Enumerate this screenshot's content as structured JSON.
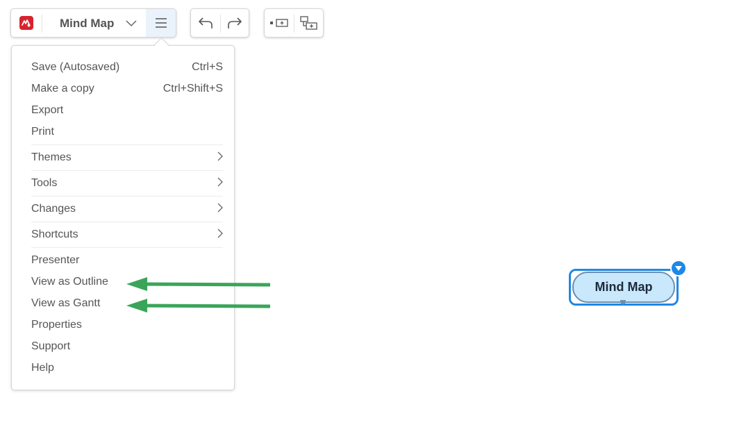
{
  "toolbar": {
    "document_title": "Mind Map",
    "logo_icon": "mindmeister-logo-icon",
    "title_dropdown_icon": "chevron-down-icon",
    "menu_icon": "hamburger-menu-icon",
    "undo_icon": "undo-icon",
    "redo_icon": "redo-icon",
    "add_sibling_icon": "add-sibling-icon",
    "add_child_icon": "add-child-icon"
  },
  "menu": {
    "items": [
      {
        "label": "Save (Autosaved)",
        "shortcut": "Ctrl+S"
      },
      {
        "label": "Make a copy",
        "shortcut": "Ctrl+Shift+S"
      },
      {
        "label": "Export",
        "shortcut": ""
      },
      {
        "label": "Print",
        "shortcut": ""
      },
      {
        "label": "Themes",
        "submenu": true
      },
      {
        "label": "Tools",
        "submenu": true
      },
      {
        "label": "Changes",
        "submenu": true
      },
      {
        "label": "Shortcuts",
        "submenu": true
      },
      {
        "label": "Presenter"
      },
      {
        "label": "View as Outline"
      },
      {
        "label": "View as Gantt"
      },
      {
        "label": "Properties"
      },
      {
        "label": "Support"
      },
      {
        "label": "Help"
      }
    ]
  },
  "canvas": {
    "root_node": "Mind Map"
  },
  "colors": {
    "brand": "#d8232f",
    "accent": "#1e88e5",
    "node_fill": "#c9e8fb",
    "annotation_arrow": "#3aa55a",
    "menu_button_active_bg": "#eaf3fc"
  }
}
